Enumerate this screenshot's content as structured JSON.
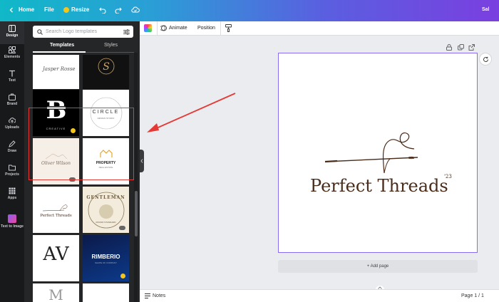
{
  "topbar": {
    "home": "Home",
    "file": "File",
    "resize": "Resize",
    "user": "Sal"
  },
  "rail": [
    {
      "label": "Design"
    },
    {
      "label": "Elements"
    },
    {
      "label": "Text"
    },
    {
      "label": "Brand"
    },
    {
      "label": "Uploads"
    },
    {
      "label": "Draw"
    },
    {
      "label": "Projects"
    },
    {
      "label": "Apps"
    },
    {
      "label": "Text to Image"
    }
  ],
  "panel": {
    "search_placeholder": "Search Logo templates",
    "tab_templates": "Templates",
    "tab_styles": "Styles",
    "thumbs": {
      "t1": "Jasper Rosse",
      "t3a": "CREATIVE",
      "t4a": "CIRCLE",
      "t4b": "DESIGN STUDIO",
      "t5": "Oliver Wilson",
      "t6a": "PROPERTY",
      "t6b": "REAL ESTATE",
      "t7": "Perfect Threads",
      "t8a": "GENTLEMAN",
      "t8b": "ROUND STANDARD",
      "t9": "AV",
      "t10": "RIMBERIO",
      "t10b": "SHAPE OF COMPANY",
      "t11": "M"
    }
  },
  "toolbar": {
    "animate": "Animate",
    "position": "Position"
  },
  "canvas": {
    "logo_text": "Perfect Threads",
    "logo_sup": "'23"
  },
  "add_page": "+ Add page",
  "bottombar": {
    "notes": "Notes",
    "page": "Page 1 / 1"
  },
  "colors": {
    "brand_thread": "#4a2c1a",
    "selection": "#8b6cf5",
    "annotation": "#e53935"
  }
}
